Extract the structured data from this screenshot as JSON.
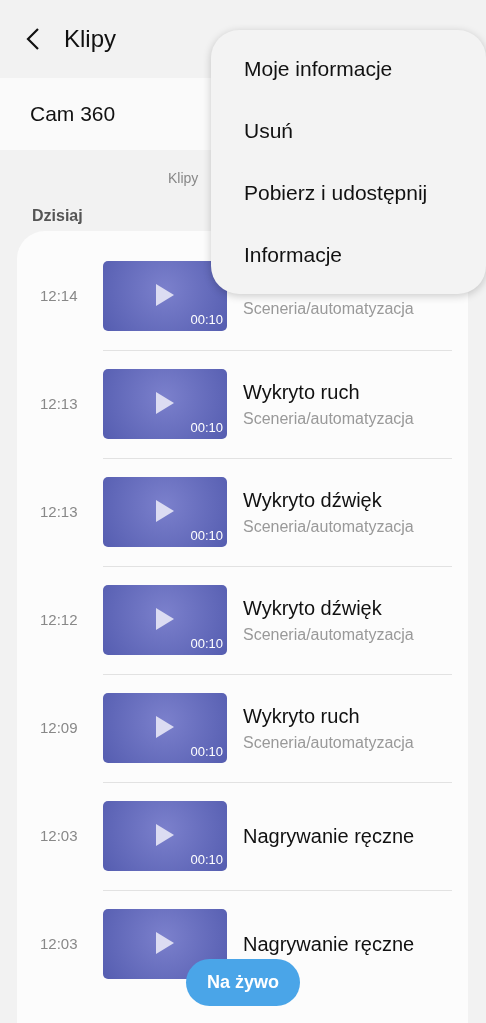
{
  "header": {
    "title": "Klipy"
  },
  "device_field": {
    "value": "Cam 360"
  },
  "info_text": "Klipy",
  "section": "Dzisiaj",
  "clips": [
    {
      "time": "12:14",
      "subtitle": "Sceneria/automatyzacja",
      "duration": "00:10"
    },
    {
      "time": "12:13",
      "title": "Wykryto ruch",
      "subtitle": "Sceneria/automatyzacja",
      "duration": "00:10"
    },
    {
      "time": "12:13",
      "title": "Wykryto dźwięk",
      "subtitle": "Sceneria/automatyzacja",
      "duration": "00:10"
    },
    {
      "time": "12:12",
      "title": "Wykryto dźwięk",
      "subtitle": "Sceneria/automatyzacja",
      "duration": "00:10"
    },
    {
      "time": "12:09",
      "title": "Wykryto ruch",
      "subtitle": "Sceneria/automatyzacja",
      "duration": "00:10"
    },
    {
      "time": "12:03",
      "title": "Nagrywanie ręczne",
      "duration": "00:10"
    },
    {
      "time": "12:03",
      "title": "Nagrywanie ręczne"
    }
  ],
  "menu": [
    "Moje informacje",
    "Usuń",
    "Pobierz i udostępnij",
    "Informacje"
  ],
  "live_button": "Na żywo"
}
